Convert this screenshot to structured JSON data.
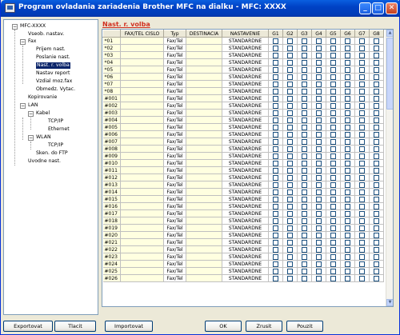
{
  "window": {
    "title": "Program ovladania zariadenia Brother MFC na dialku - MFC: XXXX"
  },
  "title_buttons": {
    "minimize": "_",
    "maximize": "□",
    "close": "✕"
  },
  "tree": [
    {
      "label": "MFC-XXXX",
      "expander": "−"
    },
    {
      "label": "Vseob. nastav."
    },
    {
      "label": "Fax",
      "expander": "−"
    },
    {
      "label": "Prijem nast."
    },
    {
      "label": "Poslanie nast."
    },
    {
      "label": "Nast. r. volba",
      "selected": true
    },
    {
      "label": "Nastav report"
    },
    {
      "label": "Vzdial moz.fax"
    },
    {
      "label": "Obmedz. Vytac."
    },
    {
      "label": "Kopirovanie"
    },
    {
      "label": "LAN",
      "expander": "−"
    },
    {
      "label": "Kabel",
      "expander": "−"
    },
    {
      "label": "TCP/IP"
    },
    {
      "label": "Ethernet"
    },
    {
      "label": "WLAN",
      "expander": "−"
    },
    {
      "label": "TCP/IP"
    },
    {
      "label": "Sken. do FTP"
    },
    {
      "label": "Uvodne nast."
    }
  ],
  "section": {
    "title": "Nast. r. volba"
  },
  "table": {
    "headers": [
      "",
      "FAX/TEL CISLO",
      "Typ",
      "DESTINACIA",
      "NASTAVENIE",
      "G1",
      "G2",
      "G3",
      "G4",
      "G5",
      "G6",
      "G7",
      "G8"
    ],
    "rows": [
      {
        "id": "*01",
        "fax": "",
        "typ": "Fax/Tel",
        "dest": "",
        "nast": "STANDARDNE"
      },
      {
        "id": "*02",
        "fax": "",
        "typ": "Fax/Tel",
        "dest": "",
        "nast": "STANDARDNE"
      },
      {
        "id": "*03",
        "fax": "",
        "typ": "Fax/Tel",
        "dest": "",
        "nast": "STANDARDNE"
      },
      {
        "id": "*04",
        "fax": "",
        "typ": "Fax/Tel",
        "dest": "",
        "nast": "STANDARDNE"
      },
      {
        "id": "*05",
        "fax": "",
        "typ": "Fax/Tel",
        "dest": "",
        "nast": "STANDARDNE"
      },
      {
        "id": "*06",
        "fax": "",
        "typ": "Fax/Tel",
        "dest": "",
        "nast": "STANDARDNE"
      },
      {
        "id": "*07",
        "fax": "",
        "typ": "Fax/Tel",
        "dest": "",
        "nast": "STANDARDNE"
      },
      {
        "id": "*08",
        "fax": "",
        "typ": "Fax/Tel",
        "dest": "",
        "nast": "STANDARDNE"
      },
      {
        "id": "#001",
        "fax": "",
        "typ": "Fax/Tel",
        "dest": "",
        "nast": "STANDARDNE"
      },
      {
        "id": "#002",
        "fax": "",
        "typ": "Fax/Tel",
        "dest": "",
        "nast": "STANDARDNE"
      },
      {
        "id": "#003",
        "fax": "",
        "typ": "Fax/Tel",
        "dest": "",
        "nast": "STANDARDNE"
      },
      {
        "id": "#004",
        "fax": "",
        "typ": "Fax/Tel",
        "dest": "",
        "nast": "STANDARDNE"
      },
      {
        "id": "#005",
        "fax": "",
        "typ": "Fax/Tel",
        "dest": "",
        "nast": "STANDARDNE"
      },
      {
        "id": "#006",
        "fax": "",
        "typ": "Fax/Tel",
        "dest": "",
        "nast": "STANDARDNE"
      },
      {
        "id": "#007",
        "fax": "",
        "typ": "Fax/Tel",
        "dest": "",
        "nast": "STANDARDNE"
      },
      {
        "id": "#008",
        "fax": "",
        "typ": "Fax/Tel",
        "dest": "",
        "nast": "STANDARDNE"
      },
      {
        "id": "#009",
        "fax": "",
        "typ": "Fax/Tel",
        "dest": "",
        "nast": "STANDARDNE"
      },
      {
        "id": "#010",
        "fax": "",
        "typ": "Fax/Tel",
        "dest": "",
        "nast": "STANDARDNE"
      },
      {
        "id": "#011",
        "fax": "",
        "typ": "Fax/Tel",
        "dest": "",
        "nast": "STANDARDNE"
      },
      {
        "id": "#012",
        "fax": "",
        "typ": "Fax/Tel",
        "dest": "",
        "nast": "STANDARDNE"
      },
      {
        "id": "#013",
        "fax": "",
        "typ": "Fax/Tel",
        "dest": "",
        "nast": "STANDARDNE"
      },
      {
        "id": "#014",
        "fax": "",
        "typ": "Fax/Tel",
        "dest": "",
        "nast": "STANDARDNE"
      },
      {
        "id": "#015",
        "fax": "",
        "typ": "Fax/Tel",
        "dest": "",
        "nast": "STANDARDNE"
      },
      {
        "id": "#016",
        "fax": "",
        "typ": "Fax/Tel",
        "dest": "",
        "nast": "STANDARDNE"
      },
      {
        "id": "#017",
        "fax": "",
        "typ": "Fax/Tel",
        "dest": "",
        "nast": "STANDARDNE"
      },
      {
        "id": "#018",
        "fax": "",
        "typ": "Fax/Tel",
        "dest": "",
        "nast": "STANDARDNE"
      },
      {
        "id": "#019",
        "fax": "",
        "typ": "Fax/Tel",
        "dest": "",
        "nast": "STANDARDNE"
      },
      {
        "id": "#020",
        "fax": "",
        "typ": "Fax/Tel",
        "dest": "",
        "nast": "STANDARDNE"
      },
      {
        "id": "#021",
        "fax": "",
        "typ": "Fax/Tel",
        "dest": "",
        "nast": "STANDARDNE"
      },
      {
        "id": "#022",
        "fax": "",
        "typ": "Fax/Tel",
        "dest": "",
        "nast": "STANDARDNE"
      },
      {
        "id": "#023",
        "fax": "",
        "typ": "Fax/Tel",
        "dest": "",
        "nast": "STANDARDNE"
      },
      {
        "id": "#024",
        "fax": "",
        "typ": "Fax/Tel",
        "dest": "",
        "nast": "STANDARDNE"
      },
      {
        "id": "#025",
        "fax": "",
        "typ": "Fax/Tel",
        "dest": "",
        "nast": "STANDARDNE"
      },
      {
        "id": "#026",
        "fax": "",
        "typ": "Fax/Tel",
        "dest": "",
        "nast": "STANDARDNE"
      }
    ]
  },
  "scrollbar": {
    "up": "▲",
    "down": "▼"
  },
  "buttons": {
    "export": "Exportovat",
    "print": "Tlacit",
    "import": "Importovat",
    "ok": "OK",
    "cancel": "Zrusit",
    "apply": "Pouzit"
  },
  "colors": {
    "title_bar": "#0042c5",
    "selected": "#0a246a",
    "section_title": "#d03020"
  }
}
